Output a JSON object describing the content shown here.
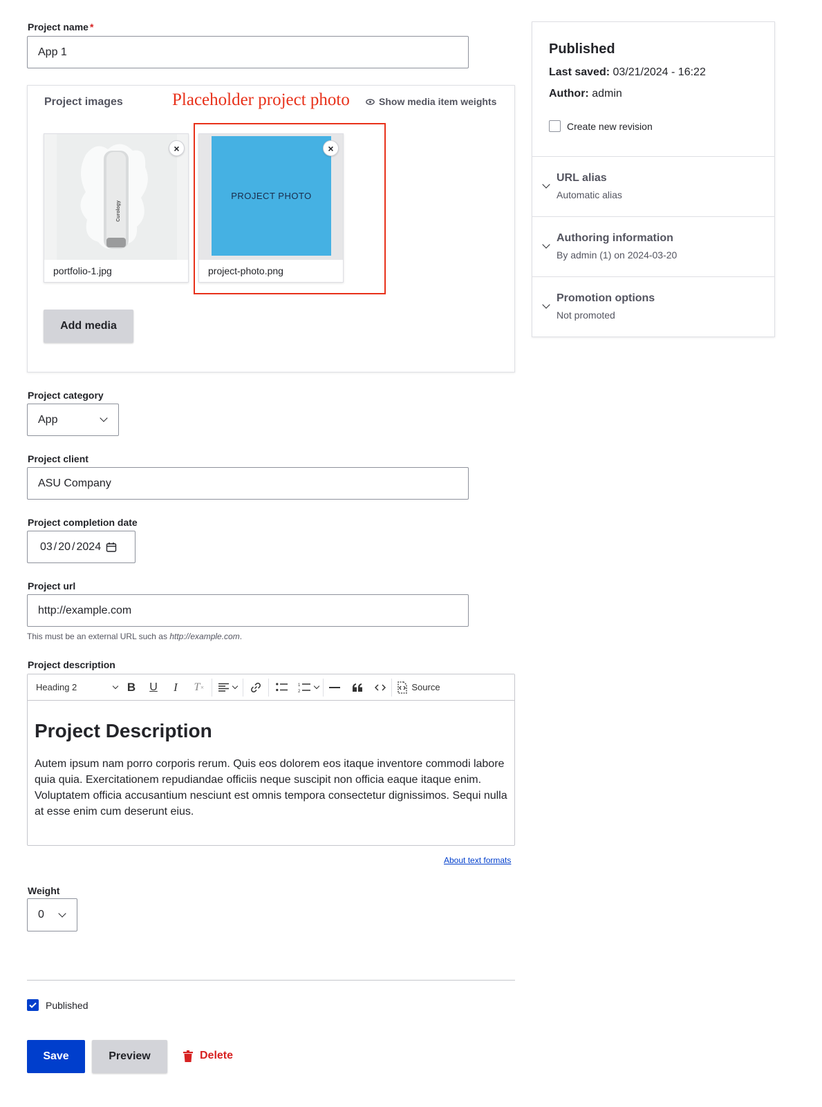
{
  "project_name": {
    "label": "Project name",
    "required_mark": "*",
    "value": "App 1"
  },
  "project_images": {
    "title": "Project images",
    "annotation": "Placeholder project photo",
    "weights_link": "Show media item weights",
    "items": [
      {
        "filename": "portfolio-1.jpg",
        "thumb_text": "Curology"
      },
      {
        "filename": "project-photo.png",
        "thumb_text": "PROJECT PHOTO"
      }
    ],
    "add_button": "Add media",
    "remove_glyph": "×"
  },
  "project_category": {
    "label": "Project category",
    "value": "App"
  },
  "project_client": {
    "label": "Project client",
    "value": "ASU Company"
  },
  "project_completion_date": {
    "label": "Project completion date",
    "month": "03",
    "day": "20",
    "year": "2024",
    "sep": "/"
  },
  "project_url": {
    "label": "Project url",
    "value": "http://example.com",
    "help_prefix": "This must be an external URL such as ",
    "help_example": "http://example.com",
    "help_suffix": "."
  },
  "project_description": {
    "label": "Project description",
    "toolbar": {
      "heading_select": "Heading 2",
      "bold": "B",
      "underline": "U",
      "italic": "I",
      "remove_format": "T",
      "source": "Source"
    },
    "heading": "Project Description",
    "body": "Autem ipsum nam porro corporis rerum. Quis eos dolorem eos itaque inventore commodi labore quia quia. Exercitationem repudiandae officiis neque suscipit non officia eaque itaque enim. Voluptatem officia accusantium nesciunt est omnis tempora consectetur dignissimos. Sequi nulla at esse enim cum deserunt eius.",
    "formats_link": "About text formats"
  },
  "weight": {
    "label": "Weight",
    "value": "0"
  },
  "published_checkbox": {
    "label": "Published",
    "checked": true
  },
  "actions": {
    "save": "Save",
    "preview": "Preview",
    "delete": "Delete"
  },
  "sidebar": {
    "status": "Published",
    "last_saved_label": "Last saved:",
    "last_saved_value": "03/21/2024 - 16:22",
    "author_label": "Author:",
    "author_value": "admin",
    "new_revision": "Create new revision",
    "sections": [
      {
        "title": "URL alias",
        "summary": "Automatic alias"
      },
      {
        "title": "Authoring information",
        "summary": "By admin (1) on 2024-03-20"
      },
      {
        "title": "Promotion options",
        "summary": "Not promoted"
      }
    ]
  },
  "colors": {
    "accent": "#003ecc",
    "danger": "#d72222",
    "annotation": "#e8311a",
    "photo": "#45b1e3"
  }
}
